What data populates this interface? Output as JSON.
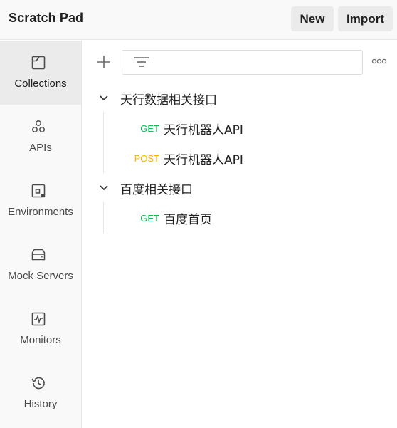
{
  "header": {
    "title": "Scratch Pad",
    "new_label": "New",
    "import_label": "Import"
  },
  "sidebar": {
    "items": [
      {
        "label": "Collections",
        "icon": "collections-icon",
        "active": true
      },
      {
        "label": "APIs",
        "icon": "apis-icon"
      },
      {
        "label": "Environments",
        "icon": "environments-icon"
      },
      {
        "label": "Mock Servers",
        "icon": "mock-servers-icon"
      },
      {
        "label": "Monitors",
        "icon": "monitors-icon"
      },
      {
        "label": "History",
        "icon": "history-icon"
      }
    ]
  },
  "toolbar": {
    "add_icon": "plus-icon",
    "filter_icon": "filter-icon",
    "more_icon": "more-options-icon",
    "filter_value": ""
  },
  "collections": [
    {
      "name": "天行数据相关接口",
      "expanded": true,
      "requests": [
        {
          "method": "GET",
          "name": "天行机器人API"
        },
        {
          "method": "POST",
          "name": "天行机器人API"
        }
      ]
    },
    {
      "name": "百度相关接口",
      "expanded": true,
      "requests": [
        {
          "method": "GET",
          "name": "百度首页"
        }
      ]
    }
  ],
  "colors": {
    "get": "#0cbb52",
    "post": "#ffb400",
    "sidebar_bg": "#f9f9f9",
    "active_bg": "#ebebeb"
  }
}
